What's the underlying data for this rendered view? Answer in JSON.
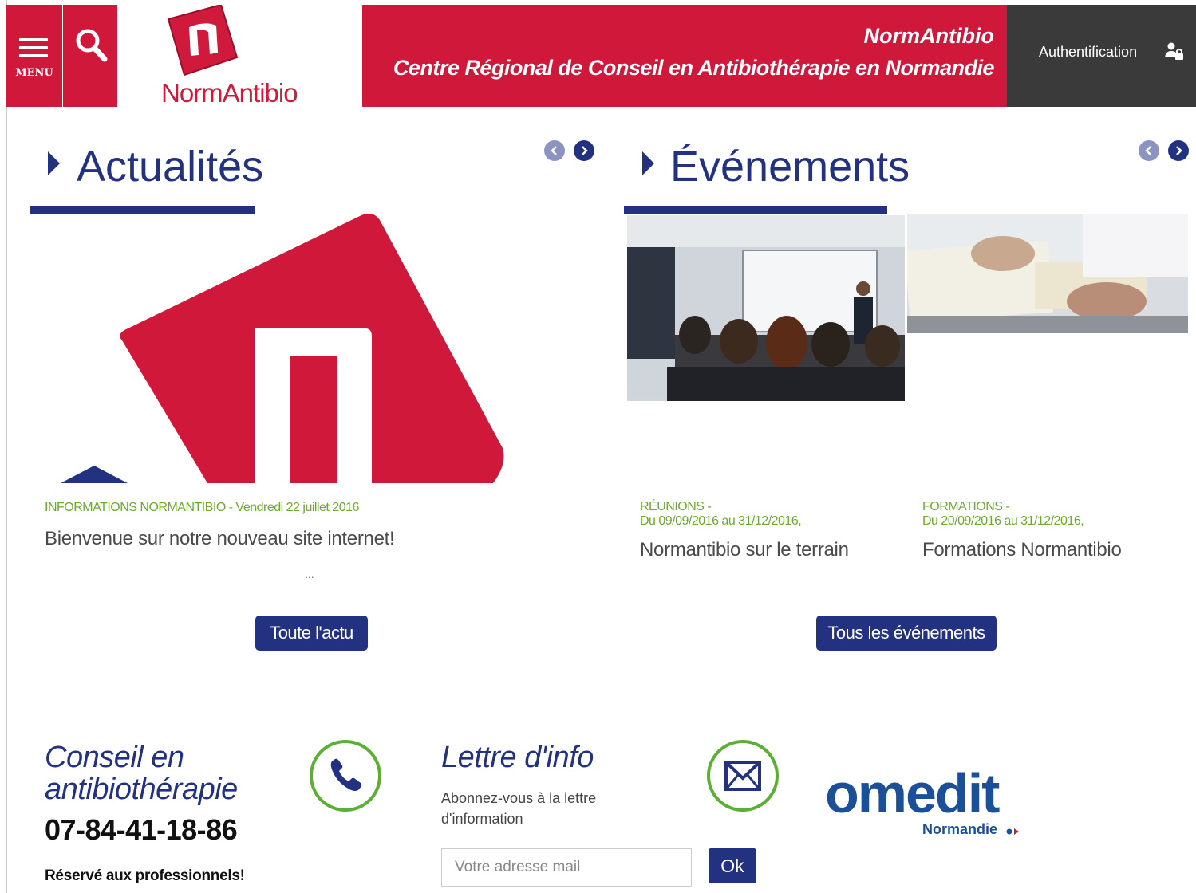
{
  "header": {
    "menu_label": "MENU",
    "logo_text": "NormAntibio",
    "banner_line1": "NormAntibio",
    "banner_line2": "Centre Régional de Conseil en Antibiothérapie en Normandie",
    "auth_label": "Authentification"
  },
  "news": {
    "title": "Actualités",
    "item": {
      "meta": "INFORMATIONS NORMANTIBIO - Vendredi 22 juillet 2016",
      "title": "Bienvenue sur notre nouveau site internet!",
      "ellipsis": "..."
    },
    "button": "Toute l'actu"
  },
  "events": {
    "title": "Événements",
    "items": [
      {
        "category": "RÉUNIONS -",
        "dates": "Du 09/09/2016 au 31/12/2016,",
        "title": "Normantibio sur le terrain"
      },
      {
        "category": "FORMATIONS -",
        "dates": "Du 20/09/2016 au 31/12/2016,",
        "title": "Formations Normantibio"
      }
    ],
    "button": "Tous les événements"
  },
  "footer": {
    "conseil_title_line1": "Conseil en",
    "conseil_title_line2": "antibiothérapie",
    "phone": "07-84-41-18-86",
    "reserved": "Réservé aux professionnels!",
    "newsletter_title": "Lettre d'info",
    "newsletter_text": "Abonnez-vous à la lettre d'information",
    "email_placeholder": "Votre adresse mail",
    "ok_label": "Ok",
    "partner_name": "omedit",
    "partner_sub": "Normandie"
  },
  "colors": {
    "brand_red": "#d0183b",
    "brand_navy": "#233181",
    "accent_green": "#6aab2e",
    "dark_gray": "#3a3a3a"
  },
  "icons": [
    "menu-icon",
    "search-icon",
    "user-lock-icon",
    "chevron-left-icon",
    "chevron-right-icon",
    "phone-icon",
    "envelope-icon"
  ]
}
